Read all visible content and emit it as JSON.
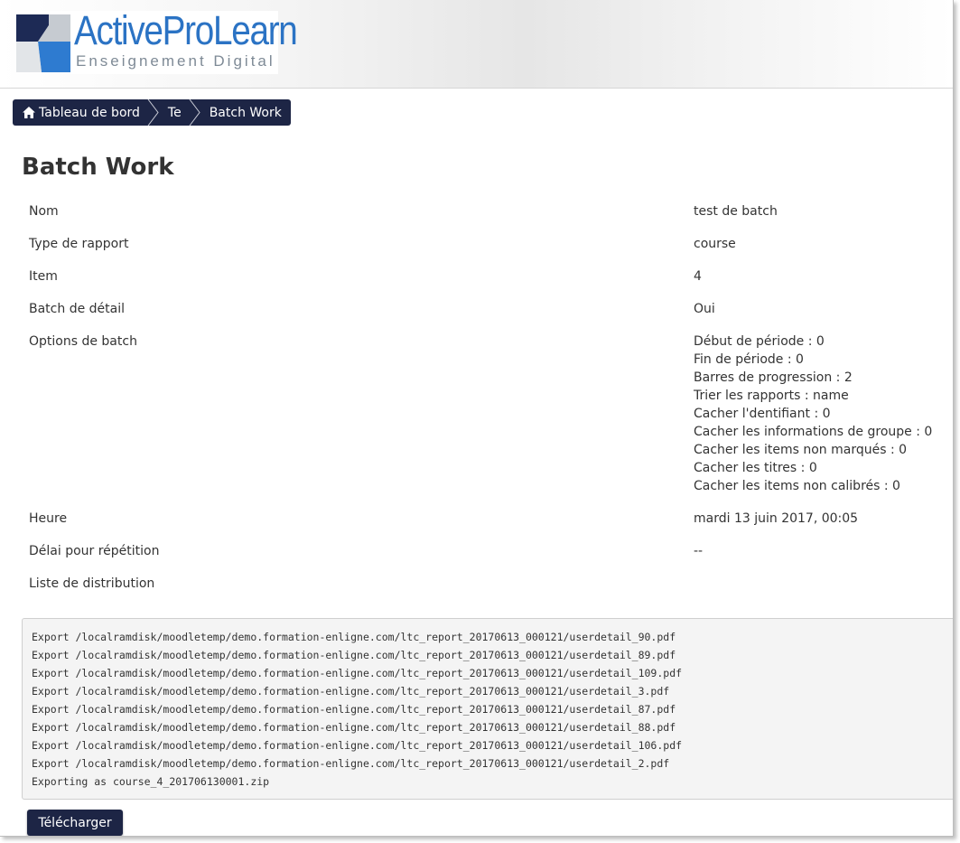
{
  "brand": {
    "name": "ActiveProLearn",
    "tagline": "Enseignement Digital",
    "colors": {
      "primary": "#2b73c4",
      "dark": "#1d2545",
      "accent": "#1e5fa8"
    }
  },
  "breadcrumb": [
    {
      "label": "Tableau de bord",
      "icon": "home-icon"
    },
    {
      "label": "Te"
    },
    {
      "label": "Batch Work"
    }
  ],
  "page": {
    "title": "Batch Work"
  },
  "details": {
    "nom": {
      "label": "Nom",
      "value": "test de batch"
    },
    "type": {
      "label": "Type de rapport",
      "value": "course"
    },
    "item": {
      "label": "Item",
      "value": "4"
    },
    "batch_detail": {
      "label": "Batch de détail",
      "value": "Oui"
    },
    "options": {
      "label": "Options de batch",
      "values": [
        "Début de période : 0",
        "Fin de période : 0",
        "Barres de progression : 2",
        "Trier les rapports : name",
        "Cacher l'dentifiant : 0",
        "Cacher les informations de groupe : 0",
        "Cacher les items non marqués : 0",
        "Cacher les titres : 0",
        "Cacher les items non calibrés : 0"
      ]
    },
    "heure": {
      "label": "Heure",
      "value": "mardi 13 juin 2017, 00:05"
    },
    "delai": {
      "label": "Délai pour répétition",
      "value": "--"
    },
    "liste": {
      "label": "Liste de distribution",
      "value": ""
    }
  },
  "log": [
    "Export /localramdisk/moodletemp/demo.formation-enligne.com/ltc_report_20170613_000121/userdetail_90.pdf",
    "Export /localramdisk/moodletemp/demo.formation-enligne.com/ltc_report_20170613_000121/userdetail_89.pdf",
    "Export /localramdisk/moodletemp/demo.formation-enligne.com/ltc_report_20170613_000121/userdetail_109.pdf",
    "Export /localramdisk/moodletemp/demo.formation-enligne.com/ltc_report_20170613_000121/userdetail_3.pdf",
    "Export /localramdisk/moodletemp/demo.formation-enligne.com/ltc_report_20170613_000121/userdetail_87.pdf",
    "Export /localramdisk/moodletemp/demo.formation-enligne.com/ltc_report_20170613_000121/userdetail_88.pdf",
    "Export /localramdisk/moodletemp/demo.formation-enligne.com/ltc_report_20170613_000121/userdetail_106.pdf",
    "Export /localramdisk/moodletemp/demo.formation-enligne.com/ltc_report_20170613_000121/userdetail_2.pdf",
    "Exporting as course_4_201706130001.zip"
  ],
  "actions": {
    "download_label": "Télécharger"
  }
}
